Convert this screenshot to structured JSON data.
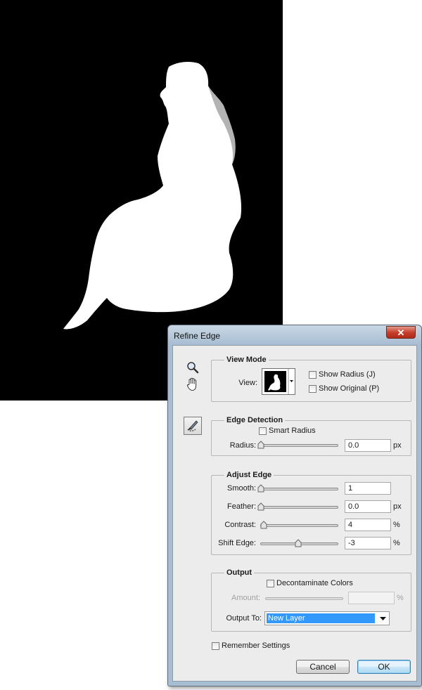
{
  "canvas": {
    "background": "#000000",
    "subject_color": "#ffffff"
  },
  "dialog": {
    "title": "Refine Edge",
    "close_glyph": "✕",
    "tools": [
      "zoom-icon",
      "hand-icon",
      "refine-radius-brush-icon"
    ],
    "view_mode": {
      "legend": "View Mode",
      "view_label": "View:",
      "show_radius": {
        "label": "Show Radius (J)",
        "checked": false
      },
      "show_original": {
        "label": "Show Original (P)",
        "checked": false
      }
    },
    "edge_detection": {
      "legend": "Edge Detection",
      "smart_radius": {
        "label": "Smart Radius",
        "checked": false
      },
      "radius": {
        "label": "Radius:",
        "value": "0.0",
        "unit": "px",
        "slider": 0.0
      }
    },
    "adjust_edge": {
      "legend": "Adjust Edge",
      "smooth": {
        "label": "Smooth:",
        "value": "1",
        "unit": "",
        "slider": 0.0
      },
      "feather": {
        "label": "Feather:",
        "value": "0.0",
        "unit": "px",
        "slider": 0.0
      },
      "contrast": {
        "label": "Contrast:",
        "value": "4",
        "unit": "%",
        "slider": 0.04
      },
      "shift_edge": {
        "label": "Shift Edge:",
        "value": "-3",
        "unit": "%",
        "slider": 0.485
      }
    },
    "output": {
      "legend": "Output",
      "decontaminate": {
        "label": "Decontaminate Colors",
        "checked": false
      },
      "amount": {
        "label": "Amount:",
        "value": "",
        "unit": "%",
        "enabled": false
      },
      "output_to": {
        "label": "Output To:",
        "value": "New Layer"
      }
    },
    "remember": {
      "label": "Remember Settings",
      "checked": false
    },
    "cancel_label": "Cancel",
    "ok_label": "OK",
    "highlight_color": "#3399ff"
  }
}
